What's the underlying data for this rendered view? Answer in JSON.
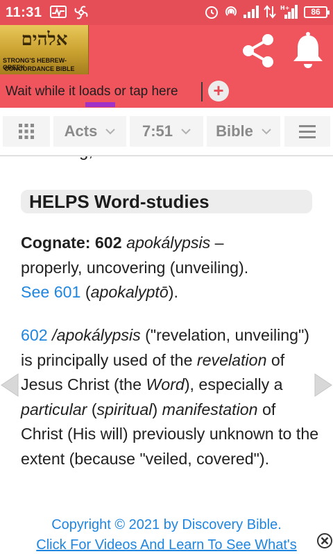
{
  "status_bar": {
    "time": "11:31",
    "battery": "86",
    "icons_left": [
      "activity-icon",
      "pinwheel-icon"
    ],
    "icons_right": [
      "alarm-icon",
      "hotspot-icon",
      "signal-icon",
      "data-arrows-icon",
      "signal-icon-2"
    ]
  },
  "header": {
    "logo_hebrew": "אלהים",
    "logo_line1": "STRONG'S HEBREW-GREEK",
    "logo_line2": "CONCORDANCE BIBLE",
    "link_text": "Wait while it loads or tap here",
    "add_label": "+"
  },
  "nav": {
    "book": "Acts",
    "verse": "7:51",
    "version": "Bible"
  },
  "content": {
    "cut_text": "revealing, revelation.",
    "section_title": "HELPS Word-studies",
    "para1": {
      "cognate_label": "Cognate: 602",
      "word": "apokálypsis",
      "dash": " –",
      "line2": "properly, uncovering (unveiling).",
      "see_link": "See 601",
      "paren_open": " (",
      "ref_word": "apokalyptō",
      "paren_close": ")."
    },
    "para2": {
      "num_link": "602",
      "slash_word": " /apokálypsis",
      "t1": " (\"revelation, unveiling\") is principally used of the ",
      "revelation": "revelation",
      "t2": " of Jesus Christ (the ",
      "word": "Word",
      "t3": "), especially a ",
      "particular": "particular",
      "t4": " (",
      "spiritual": "spiritual",
      "t5": ") ",
      "manifestation": "manifestation",
      "t6": " of Christ (His will) previously unknown to the extent (because \"veiled, covered\")."
    }
  },
  "footer": {
    "copyright": "Copyright © 2021 by Discovery Bible.",
    "videos_link": "Click For Videos And Learn To See What's"
  },
  "colors": {
    "status_bar": "#e64e57",
    "header": "#f0545c",
    "link_blue": "#1f86e0",
    "loading_bar": "#a032c8"
  }
}
